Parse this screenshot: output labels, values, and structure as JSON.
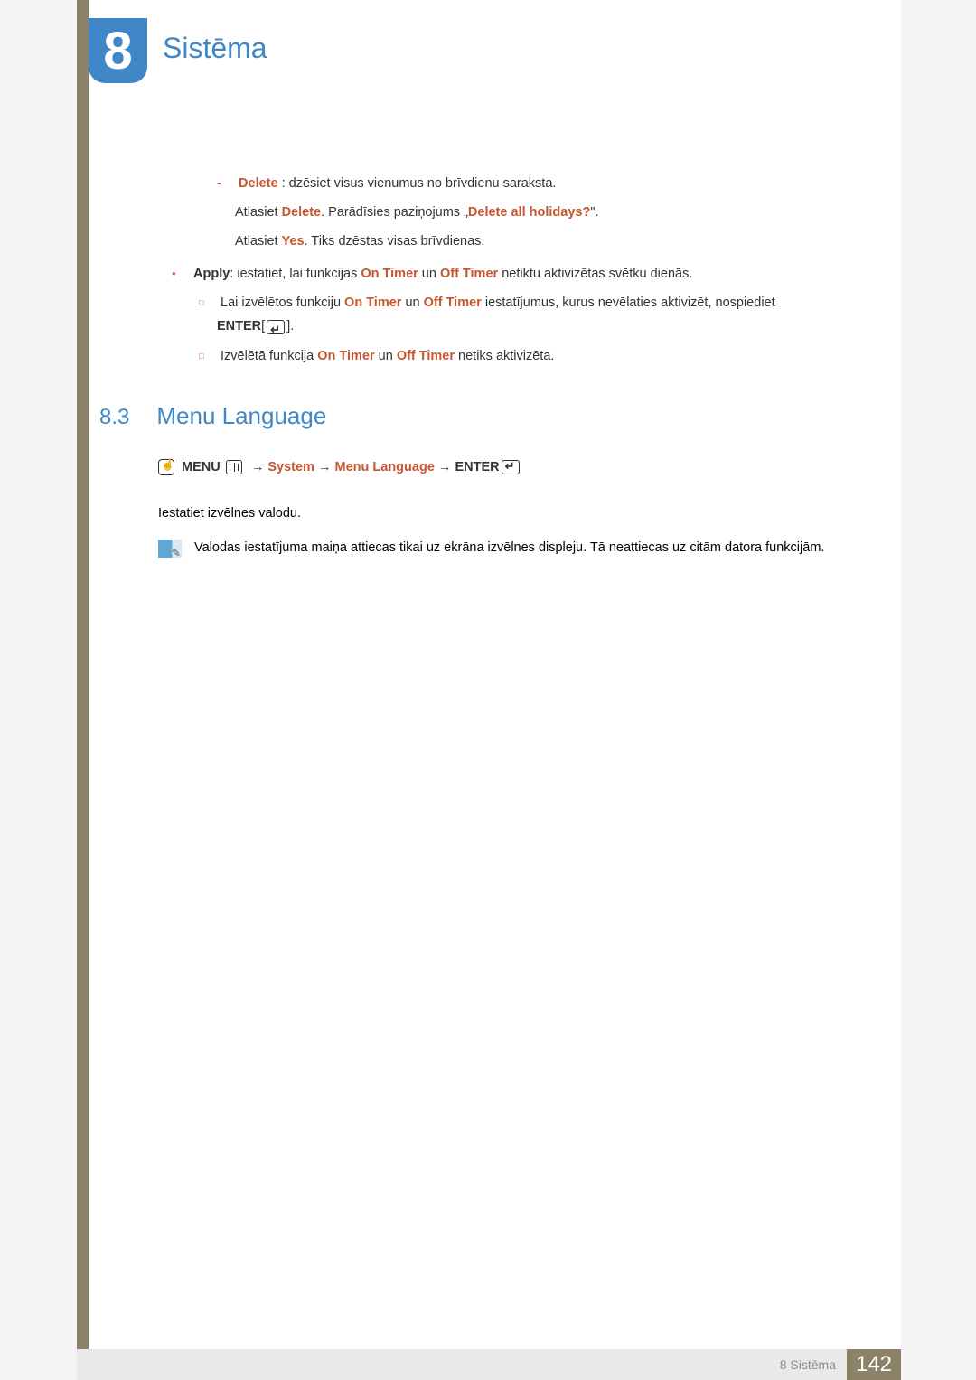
{
  "chapter": {
    "number": "8",
    "title": "Sistēma"
  },
  "body": {
    "delete_label": "Delete",
    "delete_desc": " : dzēsiet visus vienumus no brīvdienu saraksta.",
    "delete_line2_a": "Atlasiet ",
    "delete_line2_b": "Delete",
    "delete_line2_c": ". Parādīsies paziņojums „",
    "delete_line2_d": "Delete all holidays?",
    "delete_line2_e": "\".",
    "delete_line3_a": "Atlasiet ",
    "delete_line3_b": "Yes",
    "delete_line3_c": ". Tiks dzēstas visas brīvdienas.",
    "apply_label": "Apply",
    "apply_a": ": iestatiet, lai funkcijas ",
    "apply_b": "On Timer",
    "apply_c": " un ",
    "apply_d": "Off Timer",
    "apply_e": " netiktu aktivizētas svētku dienās.",
    "sub1_a": "Lai izvēlētos funkciju ",
    "sub1_b": "On Timer",
    "sub1_c": " un ",
    "sub1_d": "Off Timer",
    "sub1_e": " iestatījumus, kurus nevēlaties aktivizēt, nospiediet ",
    "sub1_f": "ENTER",
    "sub1_g": "[",
    "sub1_h": "].",
    "sub2_a": "Izvēlētā funkcija ",
    "sub2_b": "On Timer",
    "sub2_c": " un ",
    "sub2_d": "Off Timer",
    "sub2_e": " netiks aktivizēta."
  },
  "section": {
    "number": "8.3",
    "title": "Menu Language"
  },
  "nav": {
    "menu": "MENU",
    "arrow": "→",
    "system": "System",
    "menu_lang": "Menu Language",
    "enter": "ENTER"
  },
  "desc": "Iestatiet izvēlnes valodu.",
  "note": "Valodas iestatījuma maiņa attiecas tikai uz ekrāna izvēlnes displeju. Tā neattiecas uz citām datora funkcijām.",
  "footer": {
    "breadcrumb": "8 Sistēma",
    "page": "142"
  }
}
